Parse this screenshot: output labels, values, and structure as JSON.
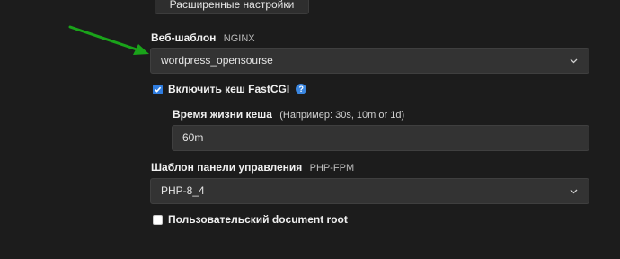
{
  "advanced_settings_button": "Расширенные настройки",
  "web_template": {
    "label": "Веб-шаблон",
    "sub": "NGINX",
    "value": "wordpress_opensourse"
  },
  "fastcgi_cache": {
    "label": "Включить кеш FastCGI",
    "checked": true,
    "help_glyph": "?"
  },
  "cache_ttl": {
    "label": "Время жизни кеша",
    "hint": "(Например: 30s, 10m or 1d)",
    "value": "60m"
  },
  "panel_template": {
    "label": "Шаблон панели управления",
    "sub": "PHP-FPM",
    "value": "PHP-8_4"
  },
  "custom_docroot": {
    "label": "Пользовательский document root",
    "checked": false
  },
  "annotation_arrow_color": "#1aa31a",
  "accent": "#2f7de0"
}
